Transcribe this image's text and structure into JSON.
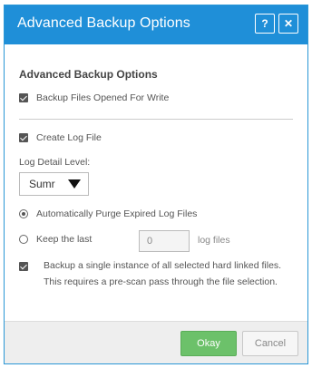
{
  "dialog": {
    "title": "Advanced Backup Options",
    "help_label": "?",
    "close_label": "✕"
  },
  "section": {
    "heading": "Advanced Backup Options"
  },
  "options": {
    "files_opened_for_write": "Backup Files Opened For Write",
    "create_log_file": "Create Log File",
    "log_detail_label": "Log Detail Level:",
    "log_detail_value": "Sumr",
    "auto_purge": "Automatically Purge Expired Log Files",
    "keep_last": "Keep the last",
    "keep_last_value": "0",
    "keep_last_unit": "log files",
    "hard_links": "Backup a single instance of all selected hard linked files. This requires a pre-scan pass through the file selection."
  },
  "footer": {
    "okay_label": "Okay",
    "cancel_label": "Cancel"
  },
  "colors": {
    "titlebar": "#1f8fd8",
    "okay_button": "#6cc16a"
  }
}
